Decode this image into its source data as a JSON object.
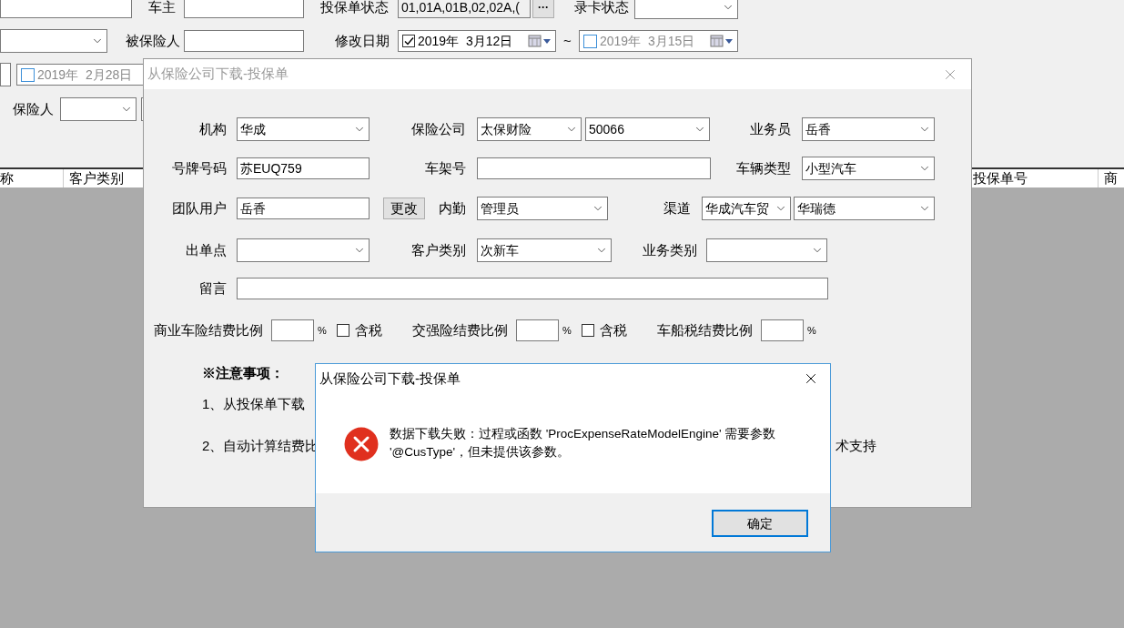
{
  "search_panel": {
    "car_owner": {
      "label": "车主"
    },
    "policy_status": {
      "label": "投保单状态",
      "value": "01,01A,01B,02,02A,(",
      "button": "···"
    },
    "card_status": {
      "label": "录卡状态"
    },
    "insured": {
      "label": "被保险人"
    },
    "modified_date": {
      "label": "修改日期",
      "from": {
        "checked": true,
        "value": "2019年  3月12日"
      },
      "separator": "~",
      "to": {
        "checked": false,
        "value": "2019年  3月15日"
      }
    },
    "other_date": {
      "checked": false,
      "value": "2019年  2月28日"
    },
    "insurer": {
      "label": "保险人"
    }
  },
  "table": {
    "columns": [
      "称",
      "客户类别",
      "投保单号",
      "商"
    ]
  },
  "dialog": {
    "title": "从保险公司下载-投保单",
    "organization": {
      "label": "机构",
      "value": "华成"
    },
    "insurance_company": {
      "label": "保险公司",
      "value": "太保财险",
      "code": "50066"
    },
    "salesperson": {
      "label": "业务员",
      "value": "岳香"
    },
    "plate_number": {
      "label": "号牌号码",
      "value": "苏EUQ759"
    },
    "vin": {
      "label": "车架号"
    },
    "vehicle_type": {
      "label": "车辆类型",
      "value": "小型汽车"
    },
    "team_user": {
      "label": "团队用户",
      "value": "岳香",
      "button": "更改"
    },
    "office_staff": {
      "label": "内勤",
      "value": "管理员"
    },
    "channel": {
      "label": "渠道",
      "value": "华成汽车贸",
      "sub_value": "华瑞德"
    },
    "issuing_point": {
      "label": "出单点"
    },
    "customer_type": {
      "label": "客户类别",
      "value": "次新车"
    },
    "business_type": {
      "label": "业务类别"
    },
    "message": {
      "label": "留言"
    },
    "fee_rates": [
      {
        "label": "商业车险结费比例",
        "unit": "%",
        "tax": {
          "label": "含税",
          "checked": false
        }
      },
      {
        "label": "交强险结费比例",
        "unit": "%",
        "tax": {
          "label": "含税",
          "checked": false
        }
      },
      {
        "label": "车船税结费比例",
        "unit": "%"
      }
    ],
    "notes": {
      "title": "※注意事项：",
      "line_1": "1、从投保单下载",
      "line_2": "2、自动计算结费比",
      "line_2_tail": "术支持"
    }
  },
  "message_box": {
    "title": "从保险公司下载-投保单",
    "kind": "error",
    "text": "数据下载失败：过程或函数 'ProcExpenseRateModelEngine' 需要参数 '@CusType'，但未提供该参数。",
    "button": "确定"
  }
}
